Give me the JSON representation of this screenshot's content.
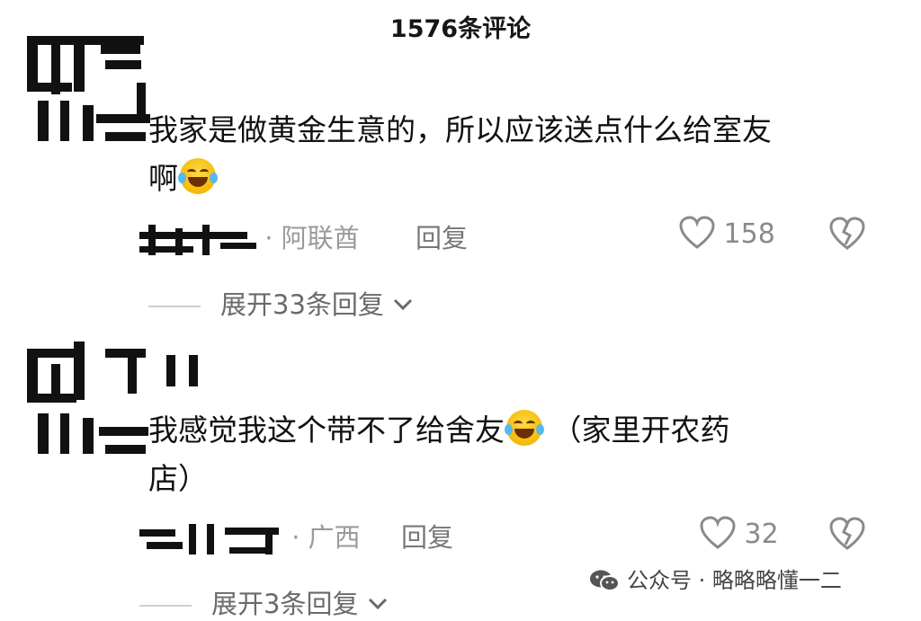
{
  "header": {
    "title": "1576条评论"
  },
  "comments": [
    {
      "text_line1": "我家是做黄金生意的，所以应该送点什么给室友",
      "text_line2": "啊",
      "emoji_icon": "laughing-rolling-emoji",
      "location": "· 阿联酋",
      "reply_label": "回复",
      "likes": "158",
      "expand_label": "展开33条回复"
    },
    {
      "text_line1": "我感觉我这个带不了给舍友",
      "text_line1_after_emoji": " （家里开农药",
      "text_line2": "店）",
      "emoji_icon": "tears-of-joy-emoji",
      "location": "· 广西",
      "reply_label": "回复",
      "likes": "32",
      "expand_label": "展开3条回复"
    }
  ],
  "watermark": {
    "text": "公众号 · 略略略懂一二",
    "icon": "wechat-icon"
  },
  "colors": {
    "text": "#111111",
    "meta": "#9a9a9a",
    "icon": "#8a8a8a",
    "divider": "#cfcfcf"
  }
}
